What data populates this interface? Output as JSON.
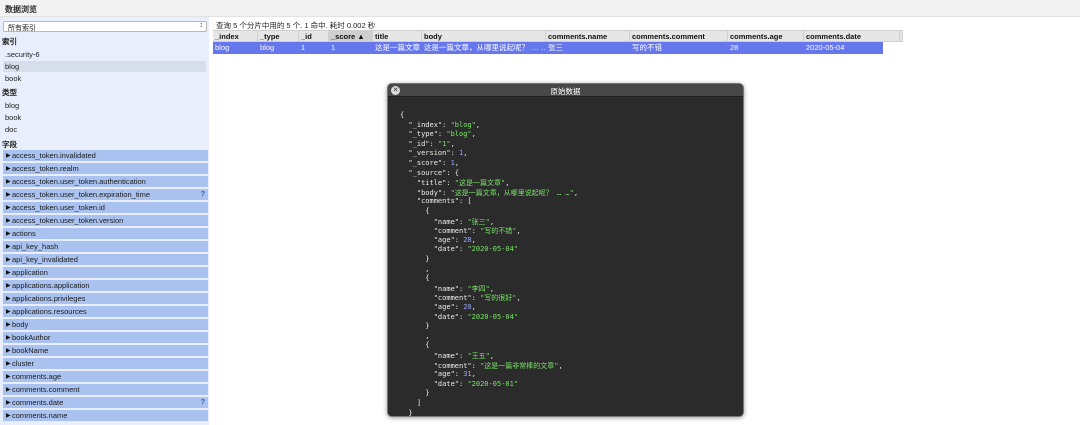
{
  "app": {
    "title": "数据浏览"
  },
  "sidebar": {
    "index_select": {
      "value": "所有索引"
    },
    "index_heading": "索引",
    "indices": [
      {
        "label": ".security-6",
        "selected": false
      },
      {
        "label": "blog",
        "selected": true
      },
      {
        "label": "book",
        "selected": false
      }
    ],
    "type_heading": "类型",
    "types": [
      {
        "label": "blog"
      },
      {
        "label": "book"
      },
      {
        "label": "doc"
      }
    ],
    "field_heading": "字段",
    "fields": [
      {
        "label": "access_token.invalidated",
        "help": ""
      },
      {
        "label": "access_token.realm",
        "help": ""
      },
      {
        "label": "access_token.user_token.authentication",
        "help": ""
      },
      {
        "label": "access_token.user_token.expiration_time",
        "help": "?"
      },
      {
        "label": "access_token.user_token.id",
        "help": ""
      },
      {
        "label": "access_token.user_token.version",
        "help": ""
      },
      {
        "label": "actions",
        "help": ""
      },
      {
        "label": "api_key_hash",
        "help": ""
      },
      {
        "label": "api_key_invalidated",
        "help": ""
      },
      {
        "label": "application",
        "help": ""
      },
      {
        "label": "applications.application",
        "help": ""
      },
      {
        "label": "applications.privileges",
        "help": ""
      },
      {
        "label": "applications.resources",
        "help": ""
      },
      {
        "label": "body",
        "help": ""
      },
      {
        "label": "bookAuthor",
        "help": ""
      },
      {
        "label": "bookName",
        "help": ""
      },
      {
        "label": "cluster",
        "help": ""
      },
      {
        "label": "comments.age",
        "help": ""
      },
      {
        "label": "comments.comment",
        "help": ""
      },
      {
        "label": "comments.date",
        "help": "?"
      },
      {
        "label": "comments.name",
        "help": ""
      }
    ]
  },
  "results": {
    "status": "查询 5 个分片中用的 5 个. 1 命中. 耗时 0.002 秒",
    "columns": [
      "_index",
      "_type",
      "_id",
      "_score ▲",
      "title",
      "body",
      "comments.name",
      "comments.comment",
      "comments.age",
      "comments.date"
    ],
    "row": [
      "blog",
      "blog",
      "1",
      "1",
      "这是一篇文章",
      "这是一篇文章，从哪里说起呢？ … …",
      "张三",
      "写的不错",
      "28",
      "2020-05-04"
    ]
  },
  "modal": {
    "title": "原始数据",
    "close_icon": "close-icon",
    "json_lines": [
      "{",
      "  \"_index\": \"blog\",",
      "  \"_type\": \"blog\",",
      "  \"_id\": \"1\",",
      "  \"_version\": 1,",
      "  \"_score\": 1,",
      "  \"_source\": {",
      "    \"title\": \"这是一篇文章\",",
      "    \"body\": \"这是一篇文章，从哪里说起呢？ … …\",",
      "    \"comments\": [",
      "      {",
      "        \"name\": \"张三\",",
      "        \"comment\": \"写的不错\",",
      "        \"age\": 28,",
      "        \"date\": \"2020-05-04\"",
      "      }",
      "      ,",
      "      {",
      "        \"name\": \"李四\",",
      "        \"comment\": \"写的很好\",",
      "        \"age\": 20,",
      "        \"date\": \"2020-05-04\"",
      "      }",
      "      ,",
      "      {",
      "        \"name\": \"王五\",",
      "        \"comment\": \"这是一篇非常棒的文章\",",
      "        \"age\": 31,",
      "        \"date\": \"2020-05-01\"",
      "      }",
      "    ]",
      "  }",
      "}"
    ]
  }
}
